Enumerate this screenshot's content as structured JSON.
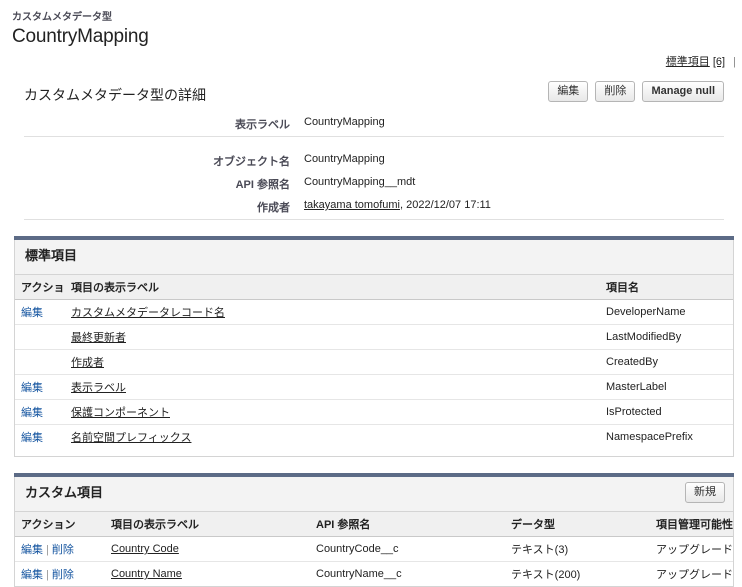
{
  "header": {
    "eyebrow": "カスタムメタデータ型",
    "title": "CountryMapping"
  },
  "quicklinks": {
    "items": [
      {
        "label": "標準項目",
        "count": "[6]"
      }
    ],
    "separator": "|"
  },
  "detail": {
    "title": "カスタムメタデータ型の詳細",
    "buttons": [
      {
        "label": "編集",
        "bold": false
      },
      {
        "label": "削除",
        "bold": false
      },
      {
        "label": "Manage null",
        "bold": true
      }
    ],
    "fields": [
      {
        "label": "表示ラベル",
        "value": "CountryMapping"
      },
      {
        "label": "オブジェクト名",
        "value": "CountryMapping"
      },
      {
        "label": "API 参照名",
        "value": "CountryMapping__mdt"
      }
    ],
    "created_by": {
      "label": "作成者",
      "user": "takayama tomofumi",
      "timestamp": ", 2022/12/07 17:11"
    }
  },
  "standard_fields": {
    "title": "標準項目",
    "columns": [
      "アクション",
      "項目の表示ラベル",
      "項目名"
    ],
    "rows": [
      {
        "action": "編集",
        "label": "カスタムメタデータレコード名",
        "name": "DeveloperName"
      },
      {
        "action": "",
        "label": "最終更新者",
        "name": "LastModifiedBy"
      },
      {
        "action": "",
        "label": "作成者",
        "name": "CreatedBy"
      },
      {
        "action": "編集",
        "label": "表示ラベル",
        "name": "MasterLabel"
      },
      {
        "action": "編集",
        "label": "保護コンポーネント",
        "name": "IsProtected"
      },
      {
        "action": "編集",
        "label": "名前空間プレフィックス",
        "name": "NamespacePrefix"
      }
    ]
  },
  "custom_fields": {
    "title": "カスタム項目",
    "new_button": "新規",
    "columns": [
      "アクション",
      "項目の表示ラベル",
      "API 参照名",
      "データ型",
      "項目管理可能性"
    ],
    "actions": {
      "edit": "編集",
      "delete": "削除",
      "separator": "|"
    },
    "rows": [
      {
        "label": "Country Code",
        "api_name": "CountryCode__c",
        "data_type": "テキスト(3)",
        "manageability": "アップグレード可能"
      },
      {
        "label": "Country Name",
        "api_name": "CountryName__c",
        "data_type": "テキスト(200)",
        "manageability": "アップグレード可能"
      }
    ]
  }
}
